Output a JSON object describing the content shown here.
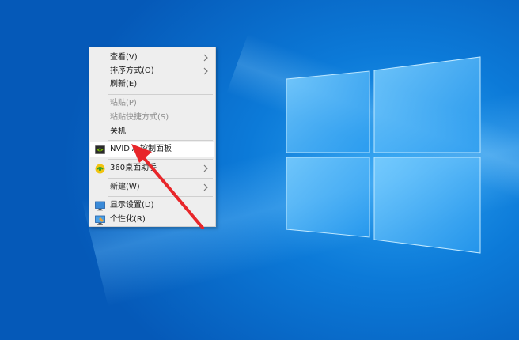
{
  "colors": {
    "desktop_dark": "#0559b8",
    "desktop_light": "#2aa0f0",
    "menu_bg": "#eeeeee",
    "annotation_arrow": "#e8262a"
  },
  "context_menu": {
    "view": {
      "label": "查看(V)",
      "icon": "chevron-right-icon"
    },
    "sort": {
      "label": "排序方式(O)",
      "icon": "chevron-right-icon"
    },
    "refresh": {
      "label": "刷新(E)"
    },
    "paste": {
      "label": "粘贴(P)",
      "disabled": true
    },
    "paste_shortcut": {
      "label": "粘贴快捷方式(S)",
      "disabled": true
    },
    "shutdown": {
      "label": "关机"
    },
    "nvidia": {
      "label": "NVIDIA 控制面板",
      "icon": "nvidia-icon"
    },
    "desktop360": {
      "label": "360桌面助手",
      "icon": "360-icon"
    },
    "new": {
      "label": "新建(W)",
      "icon": "chevron-right-icon"
    },
    "display": {
      "label": "显示设置(D)",
      "icon": "monitor-icon"
    },
    "personalize": {
      "label": "个性化(R)",
      "icon": "personalize-icon"
    }
  }
}
